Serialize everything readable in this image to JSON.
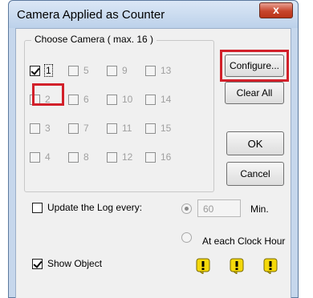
{
  "window": {
    "title": "Camera Applied as Counter",
    "close_glyph": "x"
  },
  "group": {
    "label": "Choose Camera ( max. 16 )",
    "cameras": [
      {
        "label": "1",
        "checked": true,
        "enabled": true
      },
      {
        "label": "2",
        "checked": false,
        "enabled": false
      },
      {
        "label": "3",
        "checked": false,
        "enabled": false
      },
      {
        "label": "4",
        "checked": false,
        "enabled": false
      },
      {
        "label": "5",
        "checked": false,
        "enabled": false
      },
      {
        "label": "6",
        "checked": false,
        "enabled": false
      },
      {
        "label": "7",
        "checked": false,
        "enabled": false
      },
      {
        "label": "8",
        "checked": false,
        "enabled": false
      },
      {
        "label": "9",
        "checked": false,
        "enabled": false
      },
      {
        "label": "10",
        "checked": false,
        "enabled": false
      },
      {
        "label": "11",
        "checked": false,
        "enabled": false
      },
      {
        "label": "12",
        "checked": false,
        "enabled": false
      },
      {
        "label": "13",
        "checked": false,
        "enabled": false
      },
      {
        "label": "14",
        "checked": false,
        "enabled": false
      },
      {
        "label": "15",
        "checked": false,
        "enabled": false
      },
      {
        "label": "16",
        "checked": false,
        "enabled": false
      }
    ]
  },
  "buttons": {
    "configure": "Configure...",
    "clear_all": "Clear All",
    "ok": "OK",
    "cancel": "Cancel"
  },
  "log": {
    "update_label": "Update the Log every:",
    "update_checked": false,
    "minutes_value": "60",
    "minutes_unit": "Min.",
    "every_selected": true,
    "clock_hour_label": "At each Clock Hour",
    "clock_hour_selected": false
  },
  "show_object": {
    "label": "Show Object",
    "checked": true
  },
  "status_icons": [
    "warning-icon",
    "warning-icon",
    "warning-icon"
  ],
  "colors": {
    "highlight": "#d2202a",
    "warning_fill": "#f5d90a"
  }
}
